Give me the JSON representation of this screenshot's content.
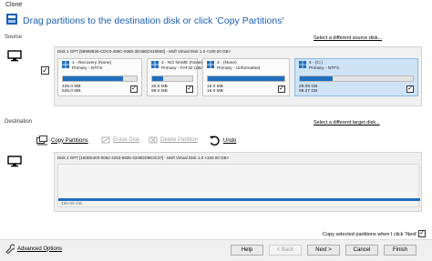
{
  "window": {
    "title": "Clone"
  },
  "header": {
    "text": "Drag partitions to the destination disk or click 'Copy Partitions'"
  },
  "source": {
    "label": "Source",
    "select_link": "Select a different source disk...",
    "disk_header": "Disk 1 GPT [58988826-CDC0-469C-9365-3D46ED41858S] - Msft    Virtual Disk    1.0  <100.00 GB>",
    "partitions": [
      {
        "name": "1 - Recovery (None)",
        "type": "Primary - NTFS",
        "used": "435.0 MB",
        "total": "529.0 MB",
        "fill": 0.82,
        "selected": false
      },
      {
        "name": "2 - NO NAME (None)",
        "type": "Primary - FAT32 (LBA)",
        "used": "26.5 MB",
        "total": "99.0 MB",
        "fill": 0.27,
        "selected": false
      },
      {
        "name": "3 - (None)",
        "type": "Primary - Unformatted",
        "used": "16.0 MB",
        "total": "16.0 MB",
        "fill": 1.0,
        "selected": false
      },
      {
        "name": "4 - (C:)",
        "type": "Primary - NTFS",
        "used": "29.05 GB",
        "total": "99.37 GB",
        "fill": 0.29,
        "selected": true
      }
    ]
  },
  "destination": {
    "label": "Destination",
    "select_link": "Select a different target disk...",
    "disk_header": "Disk 2 GPT [180D6400-0062-4263-8925-3348DD9E3C37] - Msft    Virtual Disk    1.0  <150.00 GB>",
    "free_size": "150.00 GB"
  },
  "toolbar": {
    "copy_partitions": "Copy Partitions",
    "erase_disk": "Erase Disk",
    "delete_partition": "Delete Partition",
    "undo": "Undo"
  },
  "footer": {
    "copy_checkbox_label": "Copy selected partitions when I click 'Next'",
    "advanced_options": "Advanced Options",
    "help": "Help",
    "back": "< Back",
    "next": "Next >",
    "cancel": "Cancel",
    "finish": "Finish"
  },
  "colors": {
    "accent": "#1f6fbf",
    "header_text": "#1c5fb4"
  },
  "icons": [
    "monitor-icon",
    "windows-logo-icon",
    "copy-icon",
    "erase-icon",
    "delete-icon",
    "undo-icon",
    "wrench-icon",
    "check-icon"
  ]
}
